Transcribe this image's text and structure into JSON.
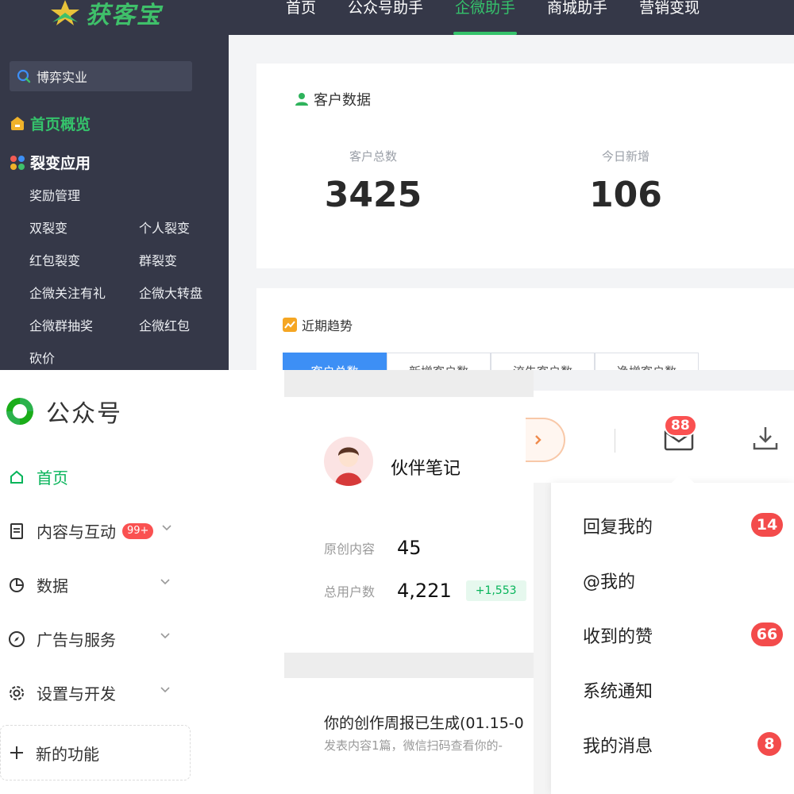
{
  "hkb": {
    "logo_text": "获客宝",
    "nav": [
      "首页",
      "公众号助手",
      "企微助手",
      "商城助手",
      "营销变现"
    ],
    "search_text": "博弈实业",
    "menu_overview": "首页概览",
    "menu_fission": "裂变应用",
    "submenu": [
      "奖励管理",
      "双裂变",
      "个人裂变",
      "红包裂变",
      "群裂变",
      "企微关注有礼",
      "企微大转盘",
      "企微群抽奖",
      "企微红包",
      "砍价"
    ],
    "customer_title": "客户数据",
    "total_label": "客户总数",
    "total_value": "3425",
    "today_label": "今日新增",
    "today_value": "106",
    "trend_title": "近期趋势",
    "tabs": [
      "客户总数",
      "新增客户数",
      "流失客户数",
      "净增客户数"
    ],
    "colors": {
      "dark": "#353848",
      "accent": "#35c26b",
      "tab_active": "#3d8ff5"
    }
  },
  "mp": {
    "brand": "公众号",
    "menu": {
      "home": "首页",
      "content": "内容与互动",
      "content_badge": "99+",
      "data": "数据",
      "ads": "广告与服务",
      "settings": "设置与开发",
      "new": "新的功能"
    },
    "icons": [
      "home-icon",
      "document-icon",
      "pie-chart-icon",
      "compass-icon",
      "gear-icon",
      "plus-icon"
    ]
  },
  "profile": {
    "name": "伙伴笔记",
    "original_label": "原创内容",
    "original_value": "45",
    "users_label": "总用户数",
    "users_value": "4,221",
    "users_delta": "+1,553",
    "weekly_title": "你的创作周报已生成(01.15-0",
    "weekly_sub": "发表内容1篇，微信扫码查看你的-"
  },
  "messages": {
    "mail_count": "88",
    "items": [
      {
        "label": "回复我的",
        "count": "14"
      },
      {
        "label": "@我的",
        "count": ""
      },
      {
        "label": "收到的赞",
        "count": "66"
      },
      {
        "label": "系统通知",
        "count": ""
      },
      {
        "label": "我的消息",
        "count": "8"
      }
    ],
    "colors": {
      "badge": "#f34b4b"
    }
  }
}
